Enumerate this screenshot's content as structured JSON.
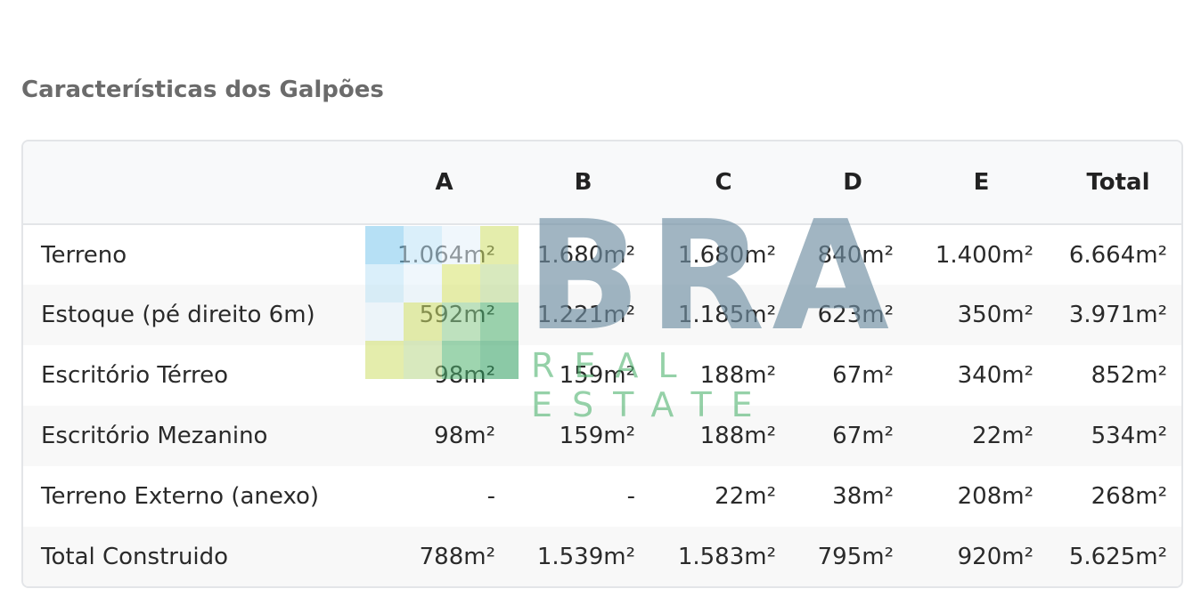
{
  "section": {
    "title": "Características dos Galpões"
  },
  "table": {
    "headers": [
      "",
      "A",
      "B",
      "C",
      "D",
      "E",
      "Total"
    ],
    "rows": [
      {
        "label": "Terreno",
        "cells": [
          "1.064m²",
          "1.680m²",
          "1.680m²",
          "840m²",
          "1.400m²",
          "6.664m²"
        ]
      },
      {
        "label": "Estoque (pé direito 6m)",
        "cells": [
          "592m²",
          "1.221m²",
          "1.185m²",
          "623m²",
          "350m²",
          "3.971m²"
        ]
      },
      {
        "label": "Escritório Térreo",
        "cells": [
          "98m²",
          "159m²",
          "188m²",
          "67m²",
          "340m²",
          "852m²"
        ]
      },
      {
        "label": "Escritório Mezanino",
        "cells": [
          "98m²",
          "159m²",
          "188m²",
          "67m²",
          "22m²",
          "534m²"
        ]
      },
      {
        "label": "Terreno Externo (anexo)",
        "cells": [
          "-",
          "-",
          "22m²",
          "38m²",
          "208m²",
          "268m²"
        ]
      },
      {
        "label": "Total Construido",
        "cells": [
          "788m²",
          "1.539m²",
          "1.583m²",
          "795m²",
          "920m²",
          "5.625m²"
        ]
      }
    ]
  },
  "watermark": {
    "logo_text": "BRA",
    "sub_text": "REAL ESTATE",
    "tile_colors": [
      "#7cc8ee",
      "#bde3f6",
      "#e4f2fb",
      "#cfe06a",
      "#bde3f6",
      "#e4f2fb",
      "#d7e36a",
      "#b9d88a",
      "#e4f2fb",
      "#cfe06a",
      "#8fd08f",
      "#4fb36f",
      "#cfe06a",
      "#b9d88a",
      "#4fb36f",
      "#2e9e5e"
    ]
  }
}
